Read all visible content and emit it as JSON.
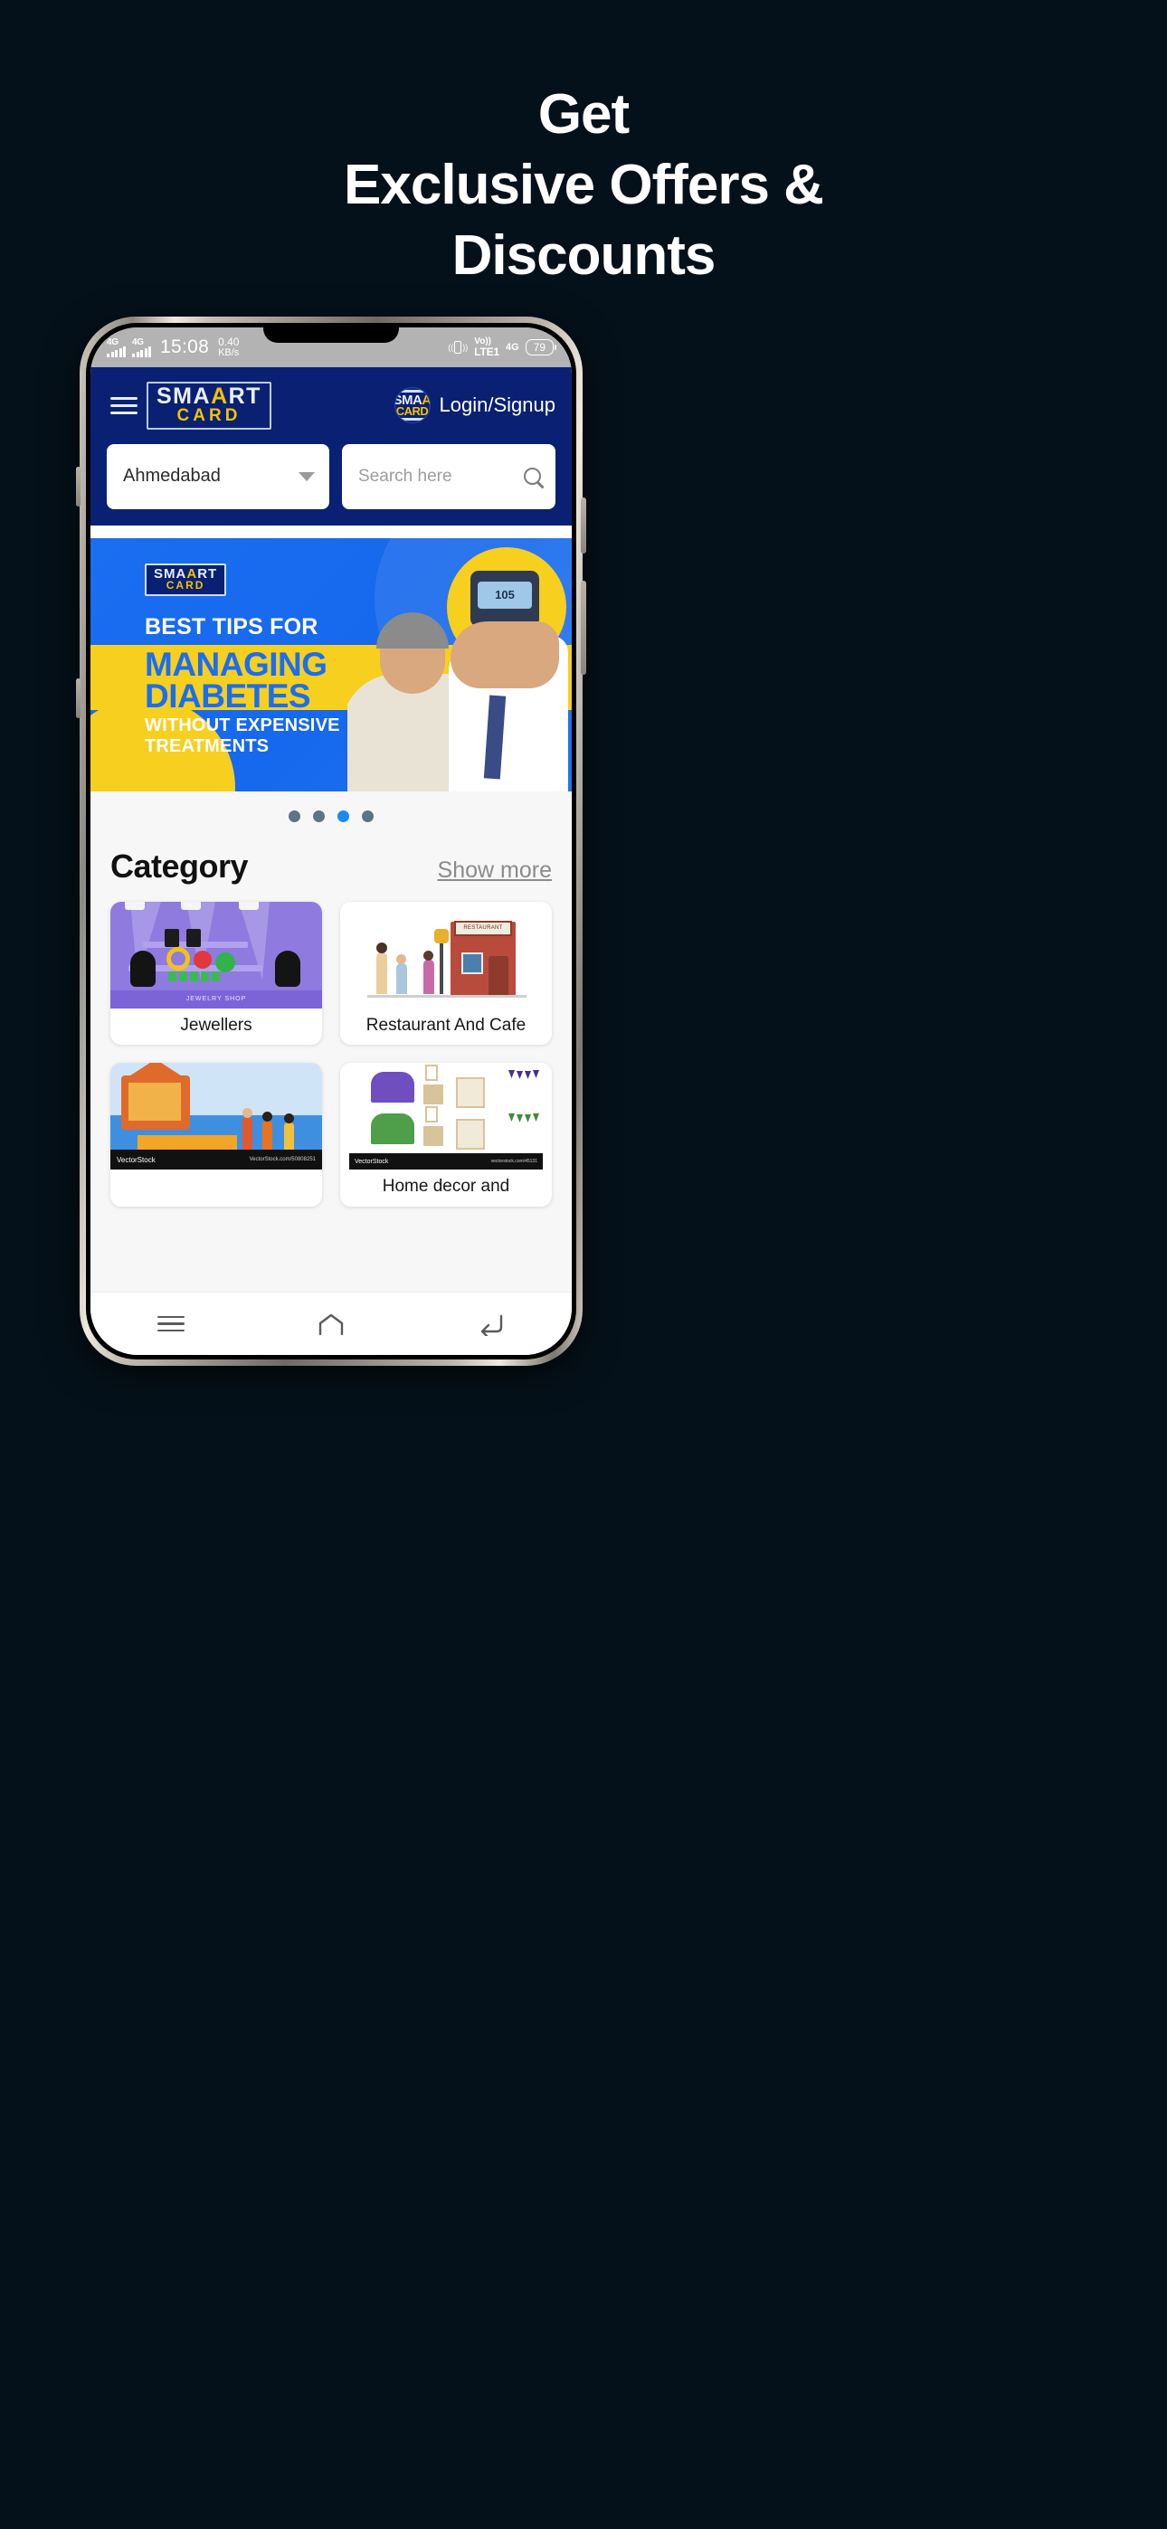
{
  "promo": {
    "line1": "Get",
    "line2": "Exclusive Offers &",
    "line3": "Discounts",
    "bg_color": "#05111a",
    "text_color": "#ffffff"
  },
  "status_bar": {
    "network_1": "4G",
    "network_2": "4G",
    "time": "15:08",
    "data_speed_value": "0.40",
    "data_speed_unit": "KB/s",
    "volte_top": "Vo))",
    "volte_bottom": "LTE1",
    "network_right": "4G",
    "battery": "79"
  },
  "app_header": {
    "menu_icon": "hamburger-icon",
    "logo_line1_a": "SMA",
    "logo_line1_b": "A",
    "logo_line1_c": "RT",
    "logo_line2": "CARD",
    "login_label": "Login/Signup",
    "brand_blue": "#0a2073",
    "brand_yellow": "#f2c300",
    "city": {
      "value": "Ahmedabad",
      "icon": "chevron-down-icon"
    },
    "search": {
      "placeholder": "Search  here",
      "icon": "search-icon"
    }
  },
  "banner": {
    "logo_l1_a": "SMA",
    "logo_l1_b": "A",
    "logo_l1_c": "RT",
    "logo_l2": "CARD",
    "title_1": "BEST TIPS FOR",
    "title_2": "MANAGING",
    "title_3": "DIABETES",
    "subtitle_1": "WITHOUT EXPENSIVE",
    "subtitle_2": "TREATMENTS",
    "meter_reading": "105",
    "bg_blue": "#1a6ef0",
    "bg_yellow": "#f6cf1f"
  },
  "carousel": {
    "total_dots": 4,
    "active_index": 2,
    "active_color": "#1a8cf0",
    "inactive_color": "#5d7482"
  },
  "category_section": {
    "title": "Category",
    "show_more_label": "Show more",
    "items": [
      {
        "label": "Jewellers",
        "image_caption": "JEWELRY SHOP"
      },
      {
        "label": "Restaurant And Cafe",
        "image_caption": "RESTAURANT"
      },
      {
        "label": "",
        "image_caption": "VectorStock",
        "watermark_right": "VectorStock.com/50808251"
      },
      {
        "label": "Home decor and",
        "image_caption": "VectorStock",
        "watermark_right": "vectorstock.com/45131"
      }
    ]
  },
  "android_nav": {
    "recent_label": "recent-apps",
    "home_label": "home",
    "back_label": "back"
  }
}
